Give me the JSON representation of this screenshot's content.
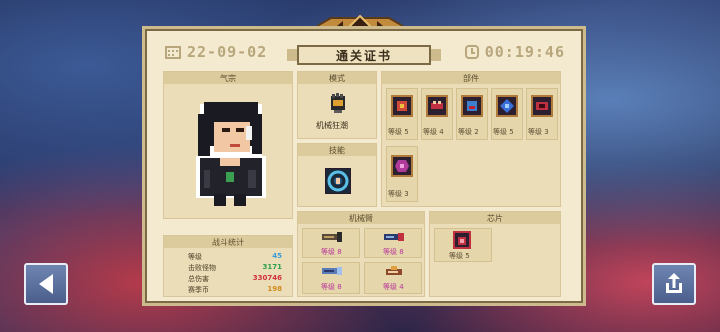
{
  "certificate": {
    "date": "22-09-02",
    "title": "通关证书",
    "time": "00:19:46"
  },
  "sections": {
    "character": "气宗",
    "mode": "模式",
    "skill": "技能",
    "parts": "部件",
    "mech_arm": "机械臂",
    "chip": "芯片",
    "battle_stats": "战斗统计"
  },
  "mode": {
    "name": "机械狂潮",
    "icon": "mech-fist-icon"
  },
  "skill": {
    "icon": "vortex-skill-icon"
  },
  "parts": [
    {
      "level": "等级 5",
      "color": "#d04a3a"
    },
    {
      "level": "等级 4",
      "color": "#c03040"
    },
    {
      "level": "等级 2",
      "color": "#3a7fd0"
    },
    {
      "level": "等级 5",
      "color": "#3a6ed8"
    },
    {
      "level": "等级 3",
      "color": "#c03040"
    },
    {
      "level": "等级 3",
      "color": "#b03a9a"
    }
  ],
  "mech_arms": [
    {
      "level": "等级 8"
    },
    {
      "level": "等级 8"
    },
    {
      "level": "等级 8"
    },
    {
      "level": "等级 4"
    }
  ],
  "chip": {
    "level": "等级 5"
  },
  "stats": [
    {
      "label": "等级",
      "value": "45",
      "color": "#3a9ad8"
    },
    {
      "label": "击败怪物",
      "value": "3171",
      "color": "#2aa04a"
    },
    {
      "label": "总伤害",
      "value": "330746",
      "color": "#d0303a"
    },
    {
      "label": "赛季币",
      "value": "198",
      "color": "#d08a1a"
    }
  ],
  "buttons": {
    "back": "back-arrow-icon",
    "share": "share-icon"
  }
}
